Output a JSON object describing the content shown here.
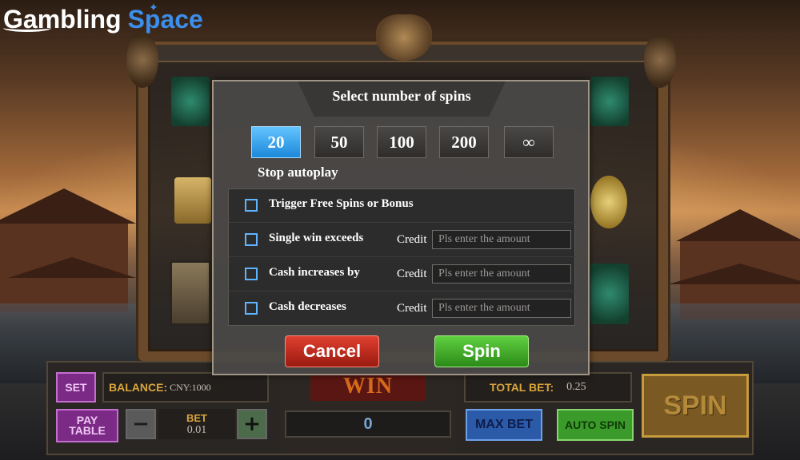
{
  "logo": {
    "part1": "Gambling",
    "part2": "Space"
  },
  "modal": {
    "title": "Select number of spins",
    "spin_counts": [
      "20",
      "50",
      "100",
      "200",
      "∞"
    ],
    "selected_count": "20",
    "stop_autoplay_label": "Stop autoplay",
    "options": [
      {
        "label": "Trigger Free Spins or Bonus",
        "checked": false
      },
      {
        "label": "Single win exceeds",
        "checked": false,
        "credit_label": "Credit",
        "placeholder": "Pls enter the amount"
      },
      {
        "label": "Cash increases by",
        "checked": false,
        "credit_label": "Credit",
        "placeholder": "Pls enter the amount"
      },
      {
        "label": "Cash decreases",
        "checked": false,
        "credit_label": "Credit",
        "placeholder": "Pls enter the amount"
      }
    ],
    "cancel_label": "Cancel",
    "spin_label": "Spin"
  },
  "console": {
    "set_label": "SET",
    "balance_label": "BALANCE:",
    "balance_value": "CNY:1000",
    "paytable_line1": "PAY",
    "paytable_line2": "TABLE",
    "minus_label": "−",
    "plus_label": "+",
    "bet_label": "BET",
    "bet_value": "0.01",
    "win_label": "WIN",
    "win_value": "0",
    "total_bet_label": "TOTAL BET:",
    "total_bet_value": "0.25",
    "max_bet_label": "MAX BET",
    "auto_spin_label": "AUTO SPIN",
    "spin_label": "SPIN"
  },
  "colors": {
    "accent_blue": "#3b8eea",
    "selected_count": "#1c88da",
    "cancel_red": "#c02a1c",
    "spin_green": "#3aa828",
    "console_gold": "#d8a53a"
  }
}
